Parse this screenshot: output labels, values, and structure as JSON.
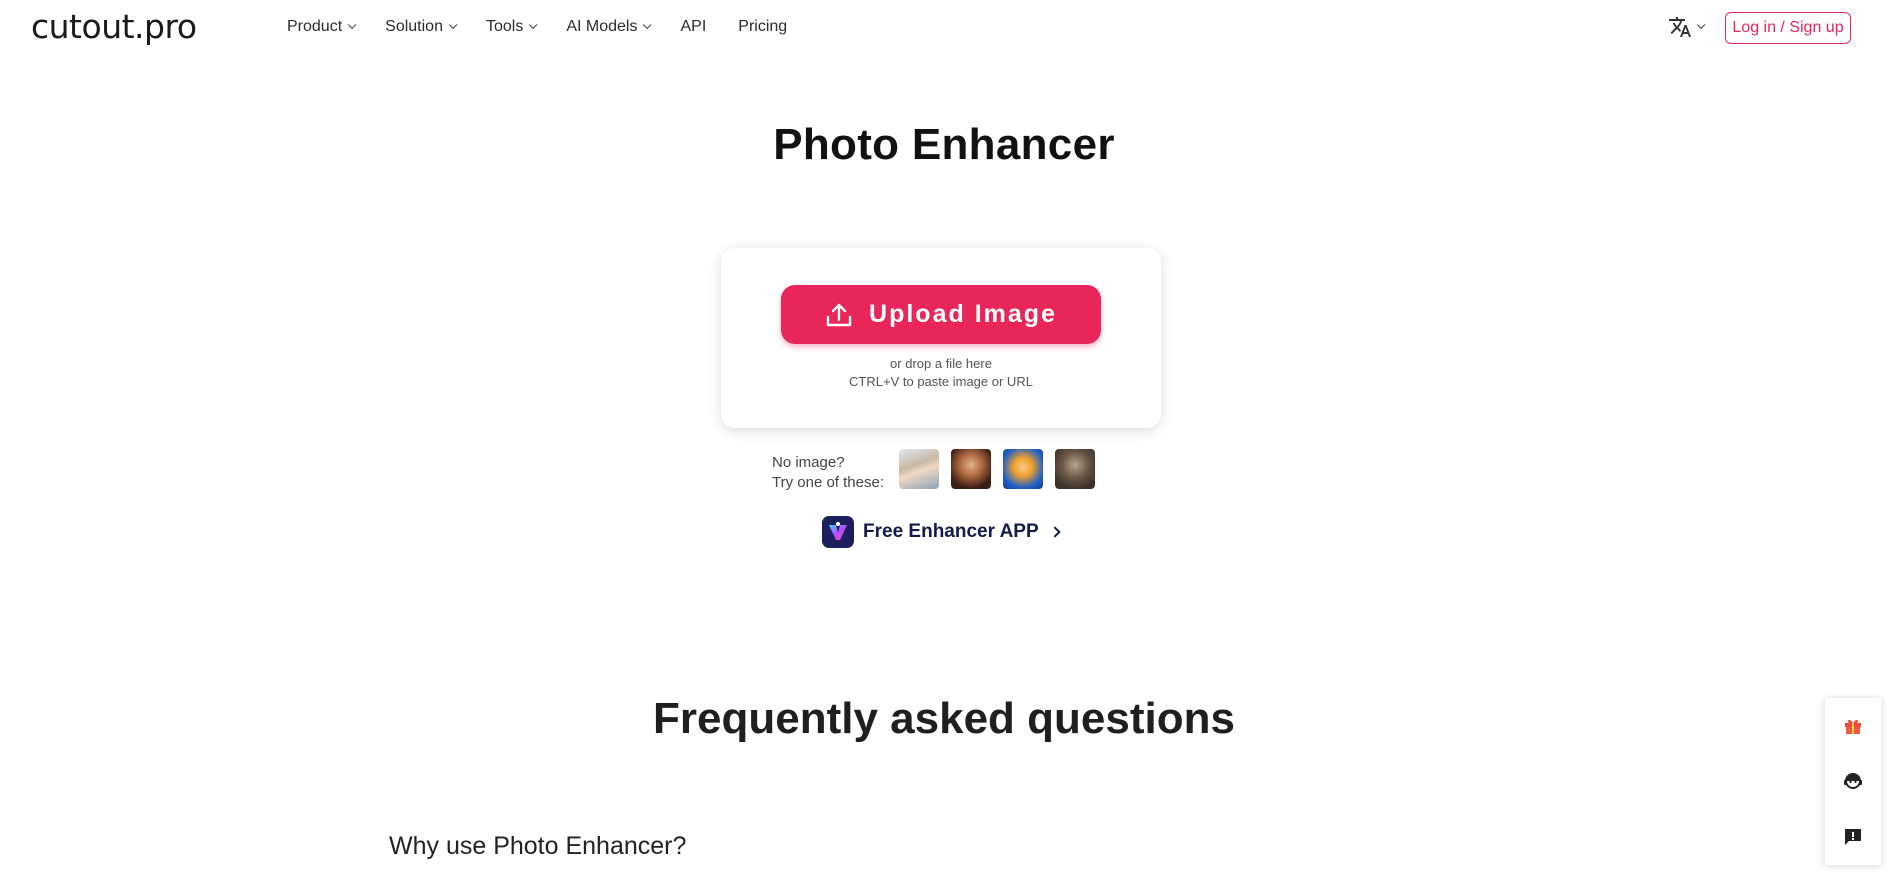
{
  "header": {
    "logo": "cutout.pro",
    "nav": [
      {
        "label": "Product",
        "has_dropdown": true
      },
      {
        "label": "Solution",
        "has_dropdown": true
      },
      {
        "label": "Tools",
        "has_dropdown": true
      },
      {
        "label": "AI Models",
        "has_dropdown": true
      },
      {
        "label": "API",
        "has_dropdown": false
      },
      {
        "label": "Pricing",
        "has_dropdown": false
      }
    ],
    "language_icon": "translate-icon",
    "login_label": "Log in / Sign up"
  },
  "main": {
    "title": "Photo Enhancer",
    "upload": {
      "button_label": "Upload Image",
      "icon": "upload-icon",
      "hint_line1": "or drop a file here",
      "hint_line2": "CTRL+V to paste image or URL"
    },
    "samples": {
      "label_line1": "No image?",
      "label_line2": "Try one of these:",
      "items": [
        "sample-girl-portrait",
        "sample-woman-portrait",
        "sample-anime-character",
        "sample-vintage-portrait"
      ]
    },
    "app_link": {
      "label": "Free Enhancer APP",
      "icon": "enhancer-app-icon"
    }
  },
  "faq": {
    "title": "Frequently asked questions",
    "questions": [
      "Why use Photo Enhancer?"
    ]
  },
  "side_panel": {
    "icons": [
      "gift-icon",
      "support-agent-icon",
      "feedback-icon"
    ]
  },
  "colors": {
    "accent": "#e8265a",
    "app_text": "#141a4a"
  }
}
